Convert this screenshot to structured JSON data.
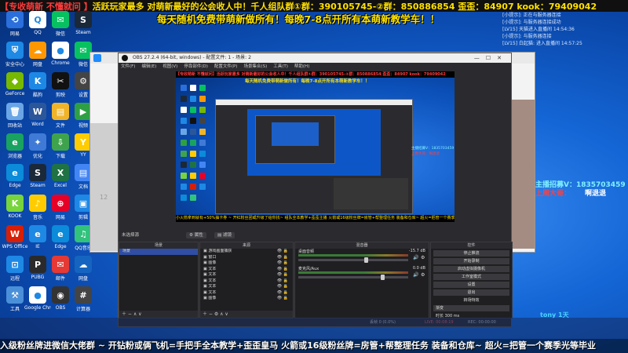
{
  "banner": {
    "part1": "【专收萌新 不懂就问 】",
    "part2": "活跃玩家最多 对萌新最好的公会收人中！",
    "part3": "千人组队群①群：390105745-②群：850886854",
    "part4": "歪歪：84907 kook：79409042",
    "line2": "每天随机免费带萌新做所有！每晚7-8点开所有本萌新教学车！！"
  },
  "desktop_icons": [
    {
      "label": "网易",
      "color": "#2a6fdb",
      "glyph": "⟲"
    },
    {
      "label": "QQ",
      "color": "#ffffff",
      "glyph": "Q"
    },
    {
      "label": "微信",
      "color": "#07c160",
      "glyph": "✉"
    },
    {
      "label": "Steam",
      "color": "#1b2838",
      "glyph": "S"
    },
    {
      "label": "安全中心",
      "color": "#1e88e5",
      "glyph": "⛨"
    },
    {
      "label": "网盘",
      "color": "#ff9800",
      "glyph": "☁"
    },
    {
      "label": "Chrome",
      "color": "#ffffff",
      "glyph": "●"
    },
    {
      "label": "微信",
      "color": "#07c160",
      "glyph": "✉"
    },
    {
      "label": "GeForce",
      "color": "#76b900",
      "glyph": "◆"
    },
    {
      "label": "酷狗",
      "color": "#1e88e5",
      "glyph": "K"
    },
    {
      "label": "剪映",
      "color": "#111111",
      "glyph": "✂"
    },
    {
      "label": "设置",
      "color": "#444444",
      "glyph": "⚙"
    },
    {
      "label": "回收站",
      "color": "#6aa5e6",
      "glyph": "🗑"
    },
    {
      "label": "Word",
      "color": "#2b579a",
      "glyph": "W"
    },
    {
      "label": "文件",
      "color": "#f0b429",
      "glyph": "▤"
    },
    {
      "label": "视频",
      "color": "#2ea043",
      "glyph": "▶"
    },
    {
      "label": "浏览器",
      "color": "#1aa260",
      "glyph": "e"
    },
    {
      "label": "优化",
      "color": "#3f7ad6",
      "glyph": "✦"
    },
    {
      "label": "下载",
      "color": "#3fa34d",
      "glyph": "⇩"
    },
    {
      "label": "YY",
      "color": "#ffcc00",
      "glyph": "Y"
    },
    {
      "label": "Edge",
      "color": "#0b8bd9",
      "glyph": "e"
    },
    {
      "label": "Steam",
      "color": "#1b2838",
      "glyph": "S"
    },
    {
      "label": "Excel",
      "color": "#1f7244",
      "glyph": "X"
    },
    {
      "label": "文档",
      "color": "#4285f4",
      "glyph": "▤"
    },
    {
      "label": "KOOK",
      "color": "#78d43c",
      "glyph": "K"
    },
    {
      "label": "音乐",
      "color": "#ffcc00",
      "glyph": "♪"
    },
    {
      "label": "网易",
      "color": "#e60026",
      "glyph": "⊕"
    },
    {
      "label": "剪辑",
      "color": "#1e88e5",
      "glyph": "▣"
    },
    {
      "label": "WPS Office",
      "color": "#d81e06",
      "glyph": "W"
    },
    {
      "label": "IE",
      "color": "#1e88e5",
      "glyph": "e"
    },
    {
      "label": "Edge",
      "color": "#0b8bd9",
      "glyph": "e"
    },
    {
      "label": "QQ音乐",
      "color": "#31c27c",
      "glyph": "♫"
    },
    {
      "label": "远程",
      "color": "#1e88e5",
      "glyph": "⊡"
    },
    {
      "label": "PUBG",
      "color": "#2a2a2a",
      "glyph": "P"
    },
    {
      "label": "邮件",
      "color": "#e53935",
      "glyph": "✉"
    },
    {
      "label": "网盘",
      "color": "#1565c0",
      "glyph": "☁"
    },
    {
      "label": "工具",
      "color": "#4a90d9",
      "glyph": "⚒"
    },
    {
      "label": "Google Chrome",
      "color": "#ffffff",
      "glyph": "●"
    },
    {
      "label": "OBS",
      "color": "#333333",
      "glyph": "◉"
    },
    {
      "label": "计算器",
      "color": "#444444",
      "glyph": "#"
    }
  ],
  "chat": [
    "[小提示]: 正在与服务器连接",
    "[小提示]: 与服务器连接成功",
    "[LV15] 天猫进入直播间 14:54:36",
    "[小提示]: 与服务器连接",
    "[LV15] 白起猫: 进入直播间 14:57:25"
  ],
  "right_promo": {
    "anchor_label": "主播招募V：",
    "anchor_id": "1835703459",
    "week_label": "上周大哥：",
    "week_name": "啊退退",
    "extra": "tony 1天"
  },
  "browser": {
    "page_num": "12"
  },
  "obs": {
    "title": "OBS 27.2.4 (64-bit, windows) - 配置文件: 1 - 场景: 2",
    "menu": [
      "文件(F)",
      "编辑(E)",
      "视图(V)",
      "停靠部件(D)",
      "配置文件(P)",
      "场景集合(S)",
      "工具(T)",
      "帮助(H)"
    ],
    "no_source": "未选择源",
    "properties": "属性",
    "filters": "滤镜",
    "docks": {
      "scenes": "场景",
      "sources": "来源",
      "mixer": "混音器",
      "controls": "控件"
    },
    "scenes": [
      "场景"
    ],
    "sources": [
      "游戏画面捕获",
      "窗口",
      "图像",
      "文本",
      "文本",
      "文本",
      "文本",
      "文本",
      "图像"
    ],
    "mixer": [
      {
        "name": "桌面音频",
        "value": "-15.7 dB",
        "knob_pct": 0.6
      },
      {
        "name": "麦克风/Aux",
        "value": "0.0 dB",
        "knob_pct": 0.75
      }
    ],
    "controls": [
      "停止推流",
      "开始录制",
      "启动虚拟摄像机",
      "工作室模式",
      "设置",
      "退出"
    ],
    "transition_label": "转场特效",
    "transition_select": "渐变",
    "duration_label": "时长",
    "duration_value": "300 ms",
    "status": {
      "dropped": "丢帧 0 (0.0%)",
      "live": "LIVE: 00:08:19",
      "rec": "REC: 00:00:00",
      "cpu": "CPU: 8.3%, 60.00 fps",
      "kbps": "kb/s: 5962"
    }
  },
  "preview_banner": "【专收萌新 不懂就问】活跃玩家最多 对萌新最好的公会收人中！千人组队群①群：390105745-②群：850886854 歪歪：84907 kook：79409042",
  "preview_line2": "每天随机免费带萌新做所有！每晚7-8点开所有本萌新教学车！！",
  "bottom_ticker": "小火箭拿到就有+50%抽卡券 ~ 开红粉丝团或升级了给你找~ 组队全本教学+歪歪主播 火箭或16级粉丝牌=房管+帮整理任务 装备和仓库~ 超火=把管一个赛季光等毕业",
  "bottom_ticker_main": "入级粉丝牌进微信大佬群 ~ 开钻粉或俩飞机=手把手全本教学+歪歪皇马   火箭或16级粉丝牌=房管+帮整理任务 装备和仓库~  超火=把管一个赛季光等毕业",
  "colors": {
    "banner_red": "#ff3b3b",
    "banner_yellow": "#ffe000",
    "promo_cyan": "#7ff0ff",
    "promo_red": "#ff4040"
  }
}
